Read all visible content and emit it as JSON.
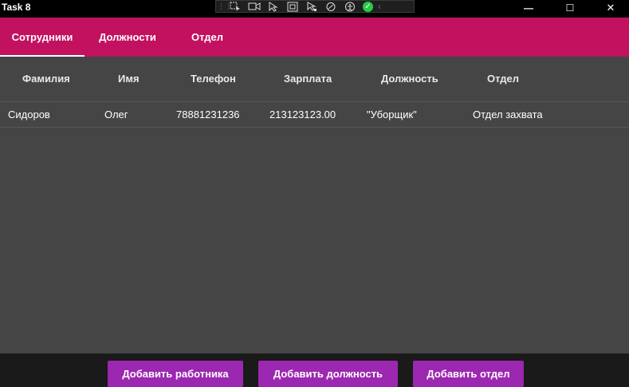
{
  "window": {
    "title": "Task 8",
    "minimize_glyph": "—",
    "maximize_glyph": "☐",
    "close_glyph": "✕"
  },
  "devtools": {
    "icons": [
      "select-element-icon",
      "video-icon",
      "pointer-icon",
      "layout-bounds-icon",
      "hot-reload-icon",
      "accessibility-icon",
      "accessibility-person-icon",
      "check-icon",
      "collapse-chevron-icon"
    ]
  },
  "tabs": [
    {
      "label": "Сотрудники",
      "selected": true
    },
    {
      "label": "Должности",
      "selected": false
    },
    {
      "label": "Отдел",
      "selected": false
    }
  ],
  "table": {
    "columns": [
      "Фамилия",
      "Имя",
      "Телефон",
      "Зарплата",
      "Должность",
      "Отдел"
    ],
    "rows": [
      [
        "Сидоров",
        "Олег",
        "78881231236",
        "213123123.00",
        "\"Уборщик\"",
        "Отдел захвата"
      ]
    ]
  },
  "buttons": {
    "add_employee": "Добавить работника",
    "add_position": "Добавить должность",
    "add_department": "Добавить отдел"
  },
  "colors": {
    "appbar": "#c2125f",
    "content_bg": "#454545",
    "button": "#9c27b0",
    "titlebar": "#000000"
  }
}
